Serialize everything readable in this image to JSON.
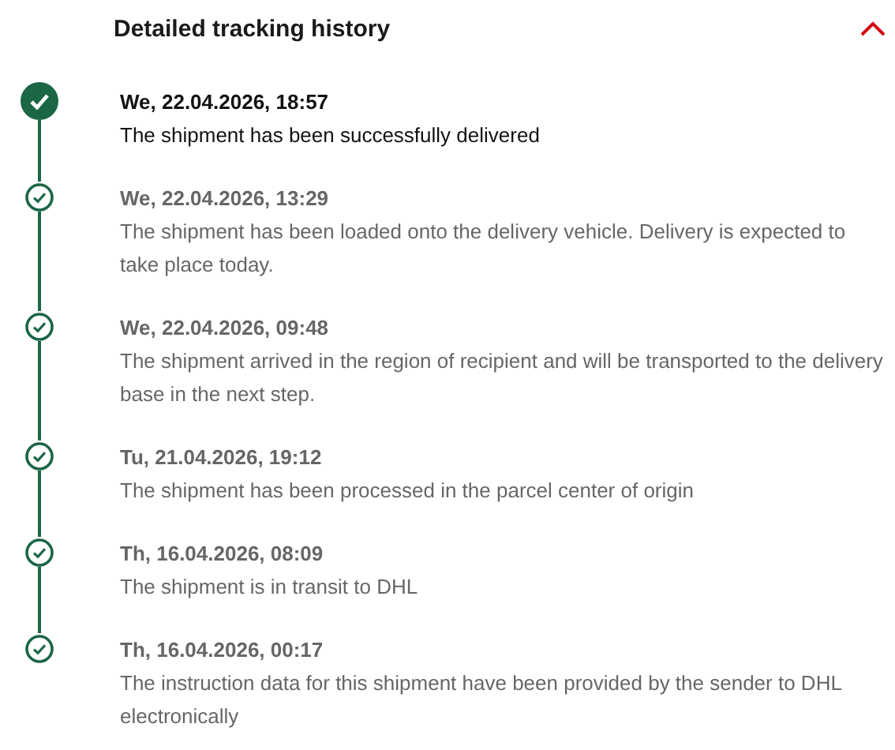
{
  "header": {
    "title": "Detailed tracking history",
    "expanded": true
  },
  "events": [
    {
      "date": "We, 22.04.2026, 18:57",
      "text": "The shipment has been successfully delivered",
      "latest": true
    },
    {
      "date": "We, 22.04.2026, 13:29",
      "text": "The shipment has been loaded onto the delivery vehicle. Delivery is expected to take place today.",
      "latest": false
    },
    {
      "date": "We, 22.04.2026, 09:48",
      "text": "The shipment arrived in the region of recipient and will be transported to the delivery base in the next step.",
      "latest": false
    },
    {
      "date": "Tu, 21.04.2026, 19:12",
      "text": "The shipment has been processed in the parcel center of origin",
      "latest": false
    },
    {
      "date": "Th, 16.04.2026, 08:09",
      "text": "The shipment is in transit to DHL",
      "latest": false
    },
    {
      "date": "Th, 16.04.2026, 00:17",
      "text": "The instruction data for this shipment have been provided by the sender to DHL electronically",
      "latest": false
    }
  ]
}
